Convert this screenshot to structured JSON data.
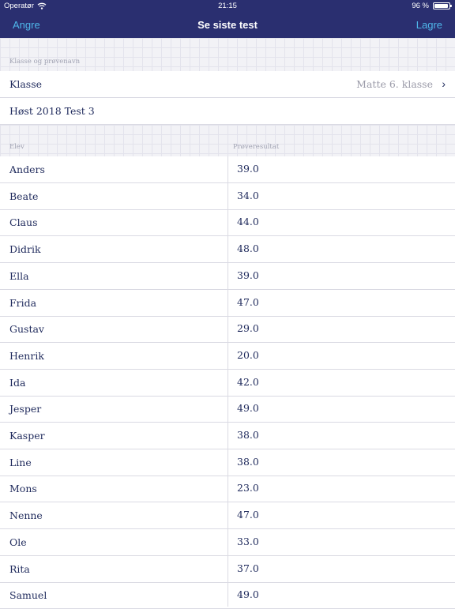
{
  "status_bar": {
    "carrier": "Operatør",
    "time": "21:15",
    "battery": "96 %",
    "battery_level": 0.96
  },
  "nav": {
    "left_button": "Angre",
    "title": "Se siste test",
    "right_button": "Lagre"
  },
  "class_section": {
    "header": "Klasse og prøvenavn",
    "class_label": "Klasse",
    "class_value": "Matte 6. klasse",
    "test_name": "Høst 2018 Test 3"
  },
  "results_section": {
    "col_student": "Elev",
    "col_result": "Prøveresultat"
  },
  "students": [
    {
      "name": "Anders",
      "score": "39.0"
    },
    {
      "name": "Beate",
      "score": "34.0"
    },
    {
      "name": "Claus",
      "score": "44.0"
    },
    {
      "name": "Didrik",
      "score": "48.0"
    },
    {
      "name": "Ella",
      "score": "39.0"
    },
    {
      "name": "Frida",
      "score": "47.0"
    },
    {
      "name": "Gustav",
      "score": "29.0"
    },
    {
      "name": "Henrik",
      "score": "20.0"
    },
    {
      "name": "Ida",
      "score": "42.0"
    },
    {
      "name": "Jesper",
      "score": "49.0"
    },
    {
      "name": "Kasper",
      "score": "38.0"
    },
    {
      "name": "Line",
      "score": "38.0"
    },
    {
      "name": "Mons",
      "score": "23.0"
    },
    {
      "name": "Nenne",
      "score": "47.0"
    },
    {
      "name": "Ole",
      "score": "33.0"
    },
    {
      "name": "Rita",
      "score": "37.0"
    },
    {
      "name": "Samuel",
      "score": "49.0"
    }
  ],
  "colors": {
    "nav_background": "#2a2f70",
    "accent": "#4fb7ea",
    "text": "#1f2a5c"
  }
}
